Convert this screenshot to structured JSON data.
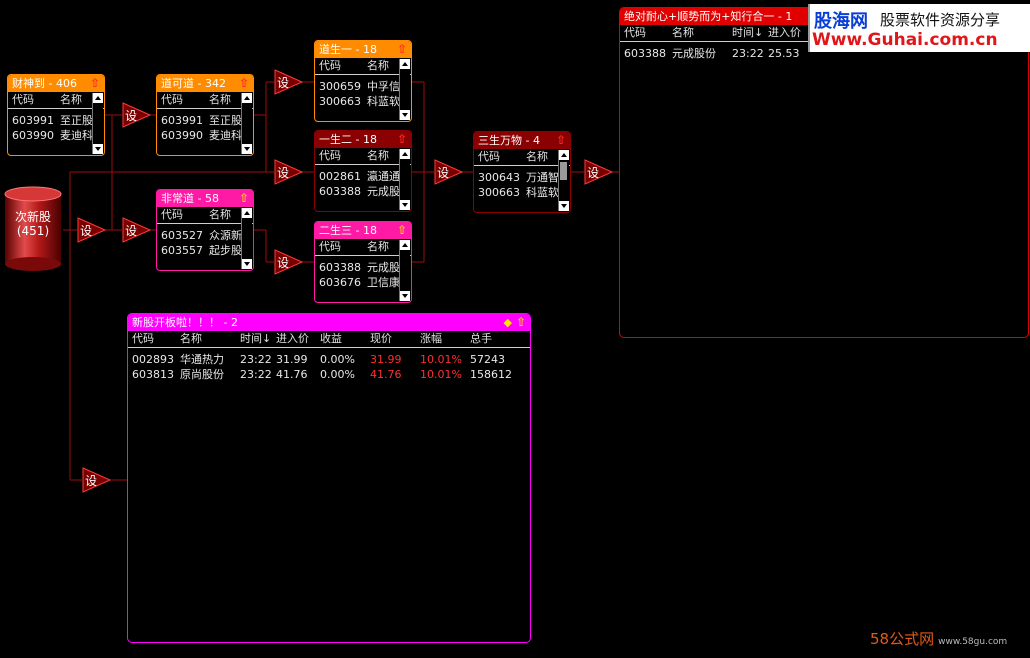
{
  "setLabel": "设",
  "source": {
    "name": "次新股",
    "count": "(451)"
  },
  "panels": {
    "caishen": {
      "title": "财神到 - 406",
      "head": [
        "代码",
        "名称"
      ],
      "rows": [
        [
          "603991",
          "至正股"
        ],
        [
          "603990",
          "麦迪科"
        ]
      ]
    },
    "daokedao": {
      "title": "道可道 - 342",
      "head": [
        "代码",
        "名称"
      ],
      "rows": [
        [
          "603991",
          "至正股"
        ],
        [
          "603990",
          "麦迪科"
        ]
      ]
    },
    "feichangdao": {
      "title": "非常道 - 58",
      "head": [
        "代码",
        "名称"
      ],
      "rows": [
        [
          "603527",
          "众源新"
        ],
        [
          "603557",
          "起步股"
        ]
      ]
    },
    "daoshengyi": {
      "title": "道生一 - 18",
      "head": [
        "代码",
        "名称"
      ],
      "rows": [
        [
          "300659",
          "中孚信"
        ],
        [
          "300663",
          "科蓝软"
        ]
      ]
    },
    "yishenger": {
      "title": "一生二 - 18",
      "head": [
        "代码",
        "名称"
      ],
      "rows": [
        [
          "002861",
          "瀛通通"
        ],
        [
          "603388",
          "元成股"
        ]
      ]
    },
    "ershengsan": {
      "title": "二生三 - 18",
      "head": [
        "代码",
        "名称"
      ],
      "rows": [
        [
          "603388",
          "元成股"
        ],
        [
          "603676",
          "卫信康"
        ]
      ]
    },
    "sansheng": {
      "title": "三生万物 - 4",
      "head": [
        "代码",
        "名称"
      ],
      "rows": [
        [
          "300643",
          "万通智"
        ],
        [
          "300663",
          "科蓝软"
        ]
      ]
    },
    "final": {
      "title": "绝对耐心+顺势而为+知行合一 - 1",
      "head": [
        "代码",
        "名称",
        "时间↓",
        "进入价"
      ],
      "rows": [
        [
          "603388",
          "元成股份",
          "23:22",
          "25.53"
        ]
      ]
    },
    "newstock": {
      "title": "新股开板啦！！！ - 2",
      "head": [
        "代码",
        "名称",
        "时间↓",
        "进入价",
        "收益",
        "现价",
        "涨幅",
        "总手"
      ],
      "rows": [
        [
          "002893",
          "华通热力",
          "23:22",
          "31.99",
          "0.00%",
          "31.99",
          "10.01%",
          "57243"
        ],
        [
          "603813",
          "原尚股份",
          "23:22",
          "41.76",
          "0.00%",
          "41.76",
          "10.01%",
          "158612"
        ]
      ]
    }
  },
  "colors": {
    "orange": "#ff8c00",
    "magenta": "#ff1aa5",
    "darkred": "#8b0000",
    "red": "#e00000",
    "purple": "#ff00ff",
    "wire": "#9b0c0c"
  },
  "watermarks": {
    "brand": "股海网",
    "slogan": "股票软件资源分享",
    "url": "Www.Guhai.com.cn",
    "bottom": "58公式网",
    "bottom_url": "www.58gu.com"
  }
}
